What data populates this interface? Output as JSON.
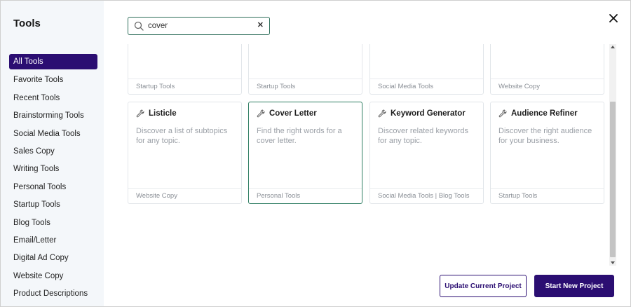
{
  "sidebar": {
    "title": "Tools",
    "items": [
      {
        "label": "All Tools",
        "active": true
      },
      {
        "label": "Favorite Tools"
      },
      {
        "label": "Recent Tools"
      },
      {
        "label": "Brainstorming Tools"
      },
      {
        "label": "Social Media Tools"
      },
      {
        "label": "Sales Copy"
      },
      {
        "label": "Writing Tools"
      },
      {
        "label": "Personal Tools"
      },
      {
        "label": "Startup Tools"
      },
      {
        "label": "Blog Tools"
      },
      {
        "label": "Email/Letter"
      },
      {
        "label": "Digital Ad Copy"
      },
      {
        "label": "Website Copy"
      },
      {
        "label": "Product Descriptions"
      }
    ]
  },
  "search": {
    "value": "cover",
    "icon": "search-icon",
    "clear_label": "✕"
  },
  "close_icon": "close-icon",
  "cards_top_row": [
    {
      "category": "Startup Tools"
    },
    {
      "category": "Startup Tools"
    },
    {
      "category": "Social Media Tools"
    },
    {
      "category": "Website Copy"
    }
  ],
  "cards": [
    {
      "title": "Listicle",
      "description": "Discover a list of subtopics for any topic.",
      "category": "Website Copy",
      "icon": "wrench-icon"
    },
    {
      "title": "Cover Letter",
      "description": "Find the right words for a cover letter.",
      "category": "Personal Tools",
      "icon": "wrench-icon",
      "selected": true
    },
    {
      "title": "Keyword Generator",
      "description": "Discover related keywords for any topic.",
      "category": "Social Media Tools | Blog Tools",
      "icon": "wrench-icon"
    },
    {
      "title": "Audience Refiner",
      "description": "Discover the right audience for your business.",
      "category": "Startup Tools",
      "icon": "wrench-icon"
    }
  ],
  "buttons": {
    "update": "Update Current Project",
    "start": "Start New Project"
  },
  "colors": {
    "accent": "#2b0e72",
    "selected_border": "#2e7d62",
    "sidebar_bg": "#f4f7fa"
  }
}
